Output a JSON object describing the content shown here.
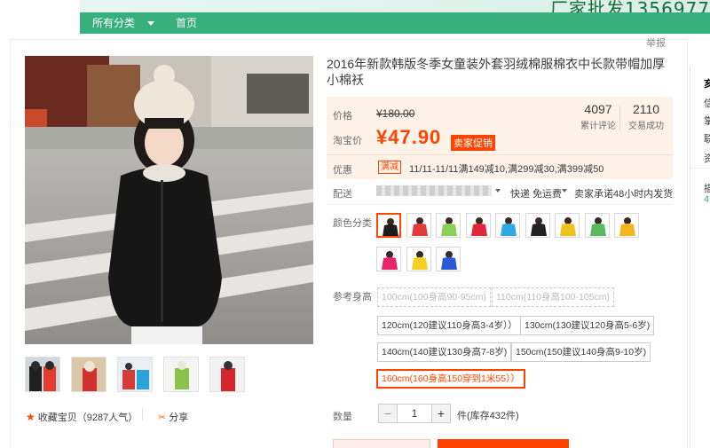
{
  "banner": {
    "promo_text": "厂家批发1356977"
  },
  "nav": {
    "all_categories": "所有分类",
    "home": "首页"
  },
  "report_label": "举报",
  "product": {
    "title": "2016年新款韩版冬季女童装外套羽绒棉服棉衣中长款带帽加厚小棉袄",
    "price_label": "价格",
    "original_price": "¥180.00",
    "promo_price_label": "淘宝价",
    "promo_price": "¥47.90",
    "promo_tag": "卖家促销",
    "reviews_count": "4097",
    "reviews_label": "累计评论",
    "sales_count": "2110",
    "sales_label": "交易成功",
    "discount_label": "优惠",
    "discount_tag": "满减",
    "discount_text": "11/11-11/11满149减10,满299减30,满399减50",
    "shipping_label": "配送",
    "shipping_text": "快递 免运费",
    "shipping_promise": "卖家承诺48小时内发货",
    "color_label": "颜色分类",
    "size_label": "参考身高",
    "sizes": [
      "100cm(100身高90-95cm)",
      "110cm(110身高100-105cm)",
      "120cm(120建议110身高3-4岁））",
      "130cm(130建议120身高5-6岁)",
      "140cm(140建议130身高7-8岁)",
      "150cm(150建议140身高9-10岁)",
      "160cm(160身高150穿到1米55））"
    ],
    "quantity_label": "数量",
    "quantity_value": "1",
    "stock_text": "件(库存432件)"
  },
  "actions": {
    "favorite": "收藏宝贝",
    "favorite_count": "（9287人气）",
    "share": "分享"
  },
  "sidebar": {
    "lines": [
      "亥",
      "信",
      "掌",
      "联",
      "资",
      "描",
      "4."
    ]
  },
  "colors": {
    "accent": "#ff4400",
    "nav_green": "#37b07d",
    "price_bg": "#fff2e8"
  }
}
